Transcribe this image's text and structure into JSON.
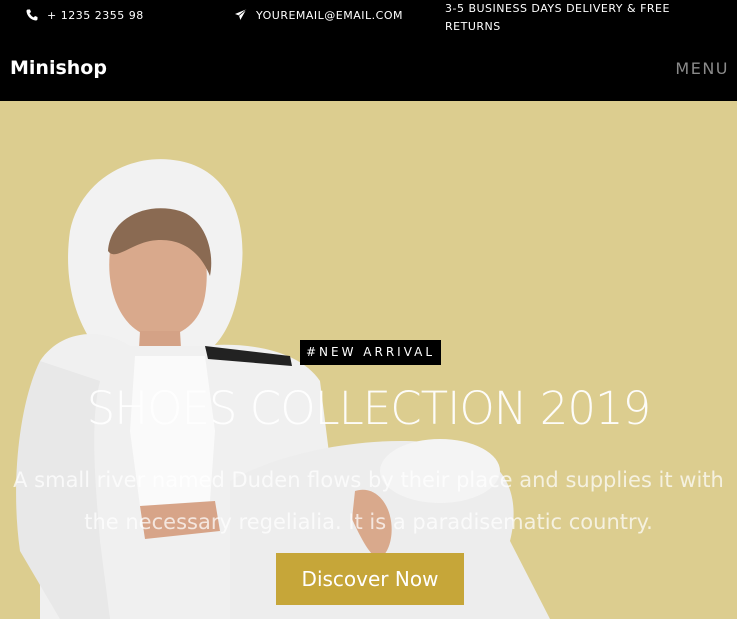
{
  "topbar": {
    "phone": "+ 1235 2355 98",
    "phone_icon": "phone-icon",
    "email": "YOUREMAIL@EMAIL.COM",
    "email_icon": "paper-plane-icon",
    "delivery": "3-5 BUSINESS DAYS DELIVERY & FREE RETURNS"
  },
  "nav": {
    "brand": "Minishop",
    "menu_label": "MENU"
  },
  "hero": {
    "badge": "#NEW ARRIVAL",
    "title": "SHOES COLLECTION 2019",
    "subtitle": "A small river named Duden flows by their place and supplies it with the necessary regelialia. It is a paradisematic country.",
    "cta_label": "Discover Now"
  },
  "colors": {
    "topbar_bg": "#000000",
    "hero_bg": "#dccd8f",
    "cta_bg": "#c6a639",
    "menu_text": "#8a8a8a"
  }
}
